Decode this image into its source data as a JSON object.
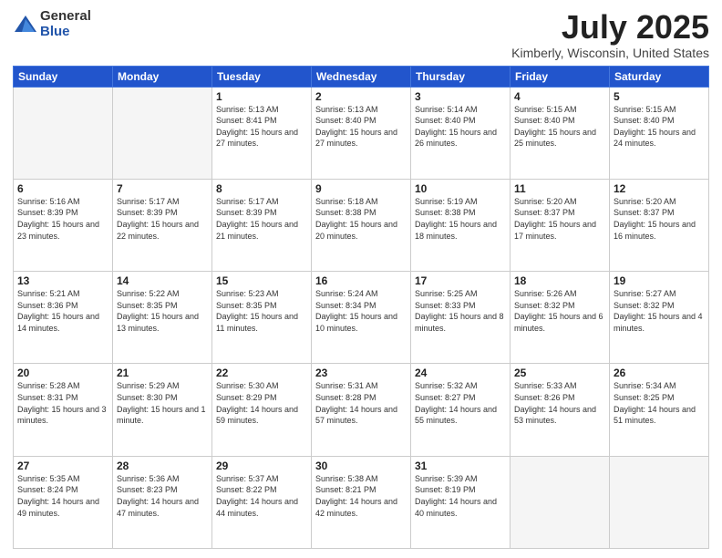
{
  "header": {
    "logo_general": "General",
    "logo_blue": "Blue",
    "month_title": "July 2025",
    "location": "Kimberly, Wisconsin, United States"
  },
  "days_of_week": [
    "Sunday",
    "Monday",
    "Tuesday",
    "Wednesday",
    "Thursday",
    "Friday",
    "Saturday"
  ],
  "weeks": [
    [
      {
        "day": "",
        "info": ""
      },
      {
        "day": "",
        "info": ""
      },
      {
        "day": "1",
        "info": "Sunrise: 5:13 AM\nSunset: 8:41 PM\nDaylight: 15 hours and 27 minutes."
      },
      {
        "day": "2",
        "info": "Sunrise: 5:13 AM\nSunset: 8:40 PM\nDaylight: 15 hours and 27 minutes."
      },
      {
        "day": "3",
        "info": "Sunrise: 5:14 AM\nSunset: 8:40 PM\nDaylight: 15 hours and 26 minutes."
      },
      {
        "day": "4",
        "info": "Sunrise: 5:15 AM\nSunset: 8:40 PM\nDaylight: 15 hours and 25 minutes."
      },
      {
        "day": "5",
        "info": "Sunrise: 5:15 AM\nSunset: 8:40 PM\nDaylight: 15 hours and 24 minutes."
      }
    ],
    [
      {
        "day": "6",
        "info": "Sunrise: 5:16 AM\nSunset: 8:39 PM\nDaylight: 15 hours and 23 minutes."
      },
      {
        "day": "7",
        "info": "Sunrise: 5:17 AM\nSunset: 8:39 PM\nDaylight: 15 hours and 22 minutes."
      },
      {
        "day": "8",
        "info": "Sunrise: 5:17 AM\nSunset: 8:39 PM\nDaylight: 15 hours and 21 minutes."
      },
      {
        "day": "9",
        "info": "Sunrise: 5:18 AM\nSunset: 8:38 PM\nDaylight: 15 hours and 20 minutes."
      },
      {
        "day": "10",
        "info": "Sunrise: 5:19 AM\nSunset: 8:38 PM\nDaylight: 15 hours and 18 minutes."
      },
      {
        "day": "11",
        "info": "Sunrise: 5:20 AM\nSunset: 8:37 PM\nDaylight: 15 hours and 17 minutes."
      },
      {
        "day": "12",
        "info": "Sunrise: 5:20 AM\nSunset: 8:37 PM\nDaylight: 15 hours and 16 minutes."
      }
    ],
    [
      {
        "day": "13",
        "info": "Sunrise: 5:21 AM\nSunset: 8:36 PM\nDaylight: 15 hours and 14 minutes."
      },
      {
        "day": "14",
        "info": "Sunrise: 5:22 AM\nSunset: 8:35 PM\nDaylight: 15 hours and 13 minutes."
      },
      {
        "day": "15",
        "info": "Sunrise: 5:23 AM\nSunset: 8:35 PM\nDaylight: 15 hours and 11 minutes."
      },
      {
        "day": "16",
        "info": "Sunrise: 5:24 AM\nSunset: 8:34 PM\nDaylight: 15 hours and 10 minutes."
      },
      {
        "day": "17",
        "info": "Sunrise: 5:25 AM\nSunset: 8:33 PM\nDaylight: 15 hours and 8 minutes."
      },
      {
        "day": "18",
        "info": "Sunrise: 5:26 AM\nSunset: 8:32 PM\nDaylight: 15 hours and 6 minutes."
      },
      {
        "day": "19",
        "info": "Sunrise: 5:27 AM\nSunset: 8:32 PM\nDaylight: 15 hours and 4 minutes."
      }
    ],
    [
      {
        "day": "20",
        "info": "Sunrise: 5:28 AM\nSunset: 8:31 PM\nDaylight: 15 hours and 3 minutes."
      },
      {
        "day": "21",
        "info": "Sunrise: 5:29 AM\nSunset: 8:30 PM\nDaylight: 15 hours and 1 minute."
      },
      {
        "day": "22",
        "info": "Sunrise: 5:30 AM\nSunset: 8:29 PM\nDaylight: 14 hours and 59 minutes."
      },
      {
        "day": "23",
        "info": "Sunrise: 5:31 AM\nSunset: 8:28 PM\nDaylight: 14 hours and 57 minutes."
      },
      {
        "day": "24",
        "info": "Sunrise: 5:32 AM\nSunset: 8:27 PM\nDaylight: 14 hours and 55 minutes."
      },
      {
        "day": "25",
        "info": "Sunrise: 5:33 AM\nSunset: 8:26 PM\nDaylight: 14 hours and 53 minutes."
      },
      {
        "day": "26",
        "info": "Sunrise: 5:34 AM\nSunset: 8:25 PM\nDaylight: 14 hours and 51 minutes."
      }
    ],
    [
      {
        "day": "27",
        "info": "Sunrise: 5:35 AM\nSunset: 8:24 PM\nDaylight: 14 hours and 49 minutes."
      },
      {
        "day": "28",
        "info": "Sunrise: 5:36 AM\nSunset: 8:23 PM\nDaylight: 14 hours and 47 minutes."
      },
      {
        "day": "29",
        "info": "Sunrise: 5:37 AM\nSunset: 8:22 PM\nDaylight: 14 hours and 44 minutes."
      },
      {
        "day": "30",
        "info": "Sunrise: 5:38 AM\nSunset: 8:21 PM\nDaylight: 14 hours and 42 minutes."
      },
      {
        "day": "31",
        "info": "Sunrise: 5:39 AM\nSunset: 8:19 PM\nDaylight: 14 hours and 40 minutes."
      },
      {
        "day": "",
        "info": ""
      },
      {
        "day": "",
        "info": ""
      }
    ]
  ]
}
